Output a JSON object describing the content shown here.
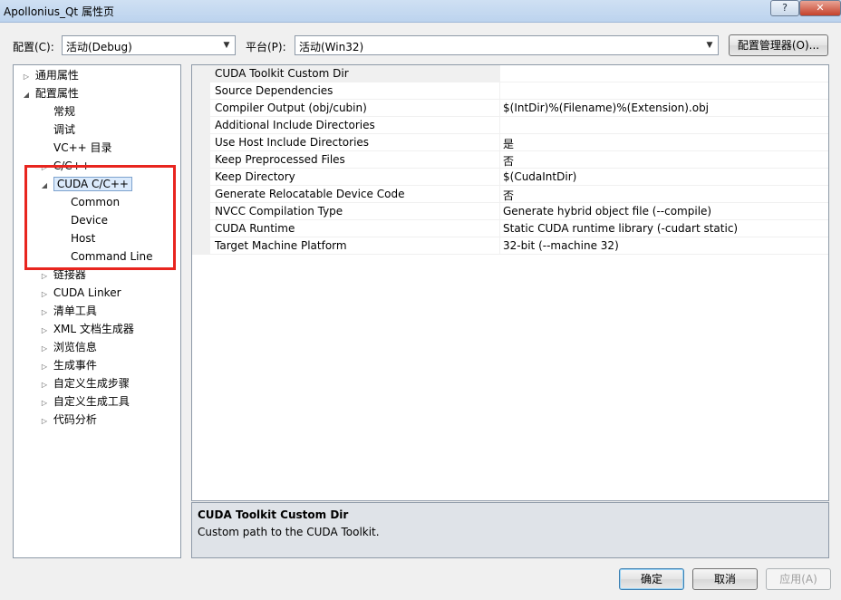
{
  "window": {
    "title": "Apollonius_Qt 属性页",
    "help_glyph": "?",
    "close_glyph": "✕"
  },
  "config": {
    "label": "配置(C):",
    "value": "活动(Debug)"
  },
  "platform": {
    "label": "平台(P):",
    "value": "活动(Win32)"
  },
  "config_manager_label": "配置管理器(O)...",
  "tree": {
    "items": [
      {
        "label": "通用属性",
        "glyph": "▷"
      },
      {
        "label": "配置属性",
        "glyph": "◢"
      },
      {
        "label": "常规"
      },
      {
        "label": "调试"
      },
      {
        "label": "VC++ 目录"
      },
      {
        "label": "C/C++",
        "glyph": "▷"
      },
      {
        "label": "CUDA C/C++",
        "glyph": "◢"
      },
      {
        "label": "Common"
      },
      {
        "label": "Device"
      },
      {
        "label": "Host"
      },
      {
        "label": "Command Line"
      },
      {
        "label": "链接器",
        "glyph": "▷"
      },
      {
        "label": "CUDA Linker",
        "glyph": "▷"
      },
      {
        "label": "清单工具",
        "glyph": "▷"
      },
      {
        "label": "XML 文档生成器",
        "glyph": "▷"
      },
      {
        "label": "浏览信息",
        "glyph": "▷"
      },
      {
        "label": "生成事件",
        "glyph": "▷"
      },
      {
        "label": "自定义生成步骤",
        "glyph": "▷"
      },
      {
        "label": "自定义生成工具",
        "glyph": "▷"
      },
      {
        "label": "代码分析",
        "glyph": "▷"
      }
    ]
  },
  "properties": [
    {
      "name": "CUDA Toolkit Custom Dir",
      "value": ""
    },
    {
      "name": "Source Dependencies",
      "value": ""
    },
    {
      "name": "Compiler Output (obj/cubin)",
      "value": "$(IntDir)%(Filename)%(Extension).obj"
    },
    {
      "name": "Additional Include Directories",
      "value": ""
    },
    {
      "name": "Use Host Include Directories",
      "value": "是"
    },
    {
      "name": "Keep Preprocessed Files",
      "value": "否"
    },
    {
      "name": "Keep Directory",
      "value": "$(CudaIntDir)"
    },
    {
      "name": "Generate Relocatable Device Code",
      "value": "否"
    },
    {
      "name": "NVCC Compilation Type",
      "value": "Generate hybrid object file (--compile)"
    },
    {
      "name": "CUDA Runtime",
      "value": "Static CUDA runtime library (-cudart static)"
    },
    {
      "name": "Target Machine Platform",
      "value": "32-bit (--machine 32)"
    }
  ],
  "description": {
    "title": "CUDA Toolkit Custom Dir",
    "text": "Custom path to the CUDA Toolkit."
  },
  "buttons": {
    "ok": "确定",
    "cancel": "取消",
    "apply": "应用(A)"
  },
  "colors": {
    "highlight_box": "#e8251f",
    "selection": "#dcebfc"
  }
}
